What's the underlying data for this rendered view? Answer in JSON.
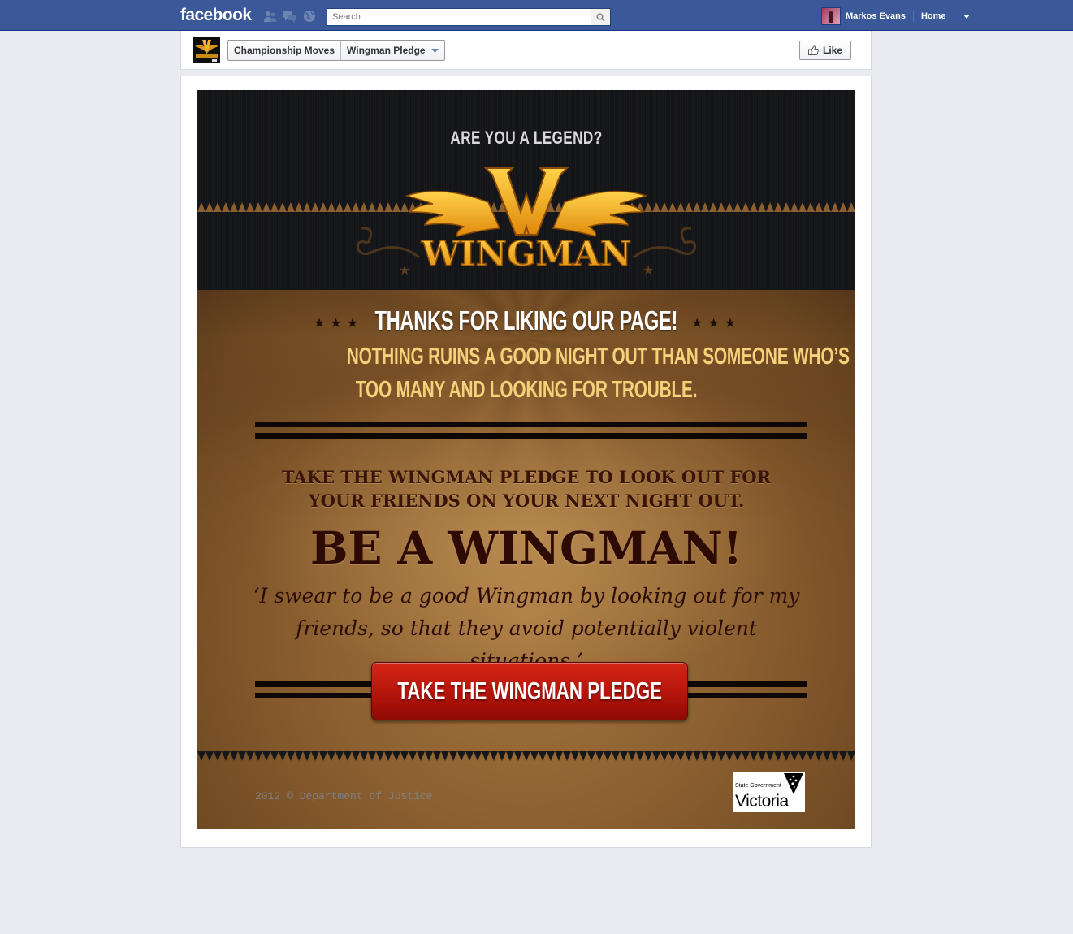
{
  "topbar": {
    "logo": "facebook",
    "search_placeholder": "Search",
    "user_name": "Markos Evans",
    "home_label": "Home",
    "jewels": [
      "friend-requests-icon",
      "messages-icon",
      "notifications-icon"
    ]
  },
  "page_header": {
    "page_name": "Championship Moves",
    "tab_name": "Wingman Pledge",
    "like_label": "Like"
  },
  "app": {
    "tagline": "ARE YOU A LEGEND?",
    "logo_text": "WINGMAN",
    "logo_letter": "W",
    "thanks": "THANKS FOR LIKING OUR PAGE!",
    "sub_line1": "NOTHING RUINS A GOOD NIGHT OUT THAN SOMEONE WHO’S HAD A FEW",
    "sub_line2": "TOO MANY AND LOOKING FOR TROUBLE.",
    "pledge_line1": "TAKE THE WINGMAN PLEDGE TO LOOK OUT FOR",
    "pledge_line2": "YOUR FRIENDS ON YOUR NEXT NIGHT OUT.",
    "be_wingman": "BE A WINGMAN!",
    "oath": "‘I swear to be a good Wingman by looking out for my friends, so that they avoid potentially violent situations.’",
    "cta_label": "TAKE THE WINGMAN PLEDGE",
    "footer_copy": "2012 © Department of Justice",
    "gov_small": "State Government",
    "gov_big": "Victoria",
    "stars": "★★★"
  },
  "colors": {
    "fb_blue": "#3b5998",
    "cta_red": "#c0190e",
    "gold": "#f5a623",
    "cream": "#f5d27a"
  }
}
